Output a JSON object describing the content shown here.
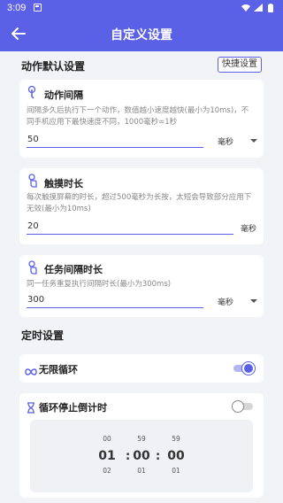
{
  "status_bar": {
    "time": "3:09"
  },
  "app_bar": {
    "title": "自定义设置"
  },
  "section_default": {
    "title": "动作默认设置",
    "quick_button": "快捷设置"
  },
  "cards": {
    "action_interval": {
      "title": "动作间隔",
      "desc": "间隔多久后执行下一个动作，数值越小速度越快(最小为10ms)，不同手机应用下最快速度不同，1000毫秒=1秒",
      "value": "50",
      "unit": "毫秒"
    },
    "touch_duration": {
      "title": "触摸时长",
      "desc": "每次触摸屏幕的时长，超过500毫秒为长按，太短会导致部分应用下无效(最小为10ms)",
      "value": "20",
      "unit": "毫秒"
    },
    "task_interval": {
      "title": "任务间隔时长",
      "desc": "同一任务重复执行间隔时长(最小为300ms)",
      "value": "300",
      "unit": "毫秒"
    }
  },
  "section_timer": {
    "title": "定时设置"
  },
  "infinite_loop": {
    "label": "无限循环",
    "enabled": true
  },
  "loop_countdown": {
    "label": "循环停止倒计时",
    "enabled": false
  },
  "time_picker": {
    "hours": {
      "prev": "00",
      "current": "01",
      "next": "02"
    },
    "minutes": {
      "prev": "59",
      "current": "00",
      "next": "01"
    },
    "seconds": {
      "prev": "59",
      "current": "00",
      "next": "01"
    },
    "separator": ":"
  },
  "colors": {
    "accent": "#5b61e6",
    "background": "#f2f3f7"
  }
}
